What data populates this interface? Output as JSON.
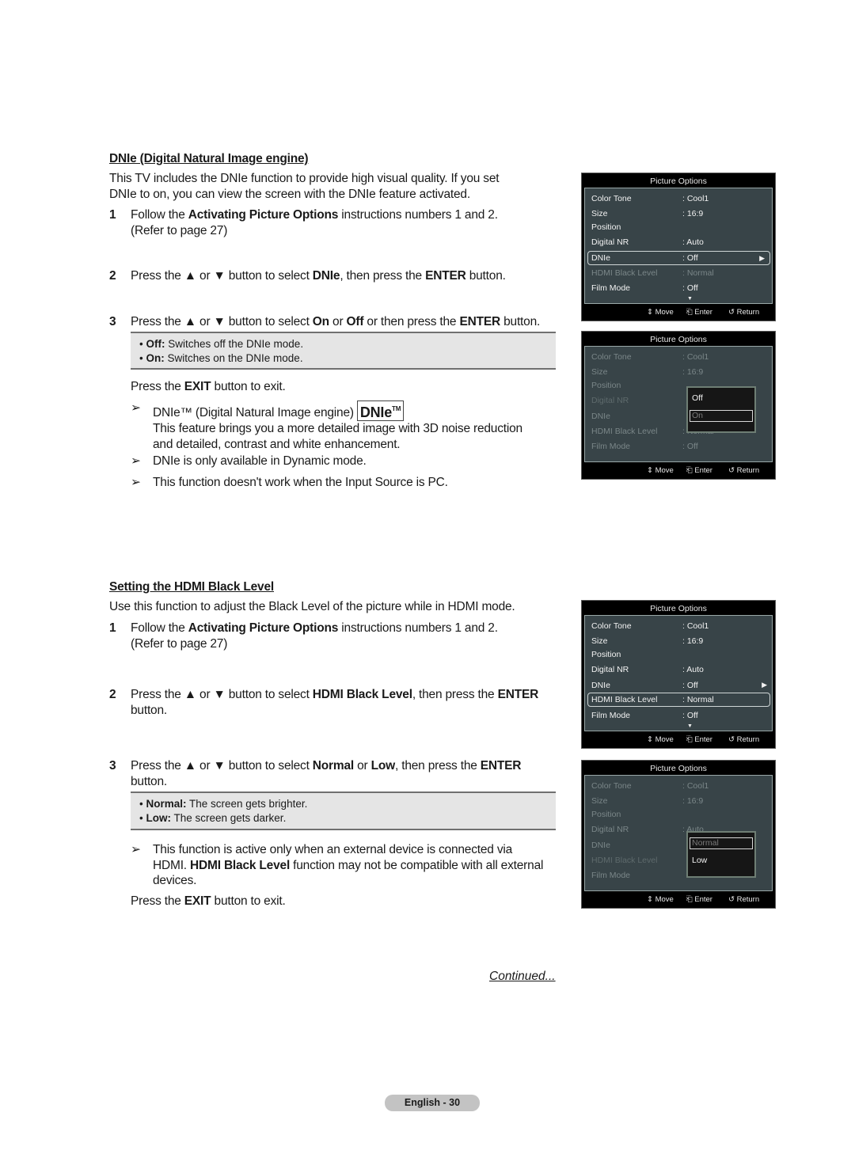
{
  "section1": {
    "heading": "DNIe (Digital Natural Image engine)",
    "intro_line1": "This TV includes the DNIe function to provide high visual quality. If you set",
    "intro_line2": "DNIe to on, you can view the screen with the DNIe feature activated.",
    "step1": {
      "num": "1",
      "pre": "Follow the ",
      "bold": "Activating Picture Options",
      "post": " instructions numbers 1 and 2.",
      "line2": "(Refer to page 27)"
    },
    "step2": {
      "num": "2",
      "a": "Press the ▲ or ▼ button to select ",
      "b1": "DNIe",
      "c": ", then press the ",
      "b2": "ENTER",
      "d": " button."
    },
    "step3": {
      "num": "3",
      "a": "Press the ▲ or ▼ button to select ",
      "b1": "On",
      "c": " or ",
      "b2": "Off",
      "d": " or then press the ",
      "b3": "ENTER",
      "e": " button."
    },
    "notes": [
      {
        "bullet": "• ",
        "term": "Off:",
        "desc": " Switches off the DNIe mode."
      },
      {
        "bullet": "• ",
        "term": "On:",
        "desc": " Switches on the DNIe mode."
      }
    ],
    "exit": {
      "pre": "Press the ",
      "bold": "EXIT",
      "post": " button to exit."
    },
    "tips": [
      {
        "arrow": "➢",
        "line1": "DNIe™ (Digital Natural Image engine)",
        "logo": "DNIe",
        "logo_tm": "TM",
        "line2": "This feature brings you a more detailed image with 3D noise reduction",
        "line3": "and detailed, contrast and white enhancement."
      },
      {
        "arrow": "➢",
        "line1": "DNIe is only available in Dynamic mode."
      },
      {
        "arrow": "➢",
        "line1": "This function doesn't work when the Input Source is PC."
      }
    ]
  },
  "section2": {
    "heading": "Setting the HDMI Black Level",
    "intro": "Use this function to adjust the Black Level of the picture while in HDMI mode.",
    "step1": {
      "num": "1",
      "pre": "Follow the ",
      "bold": "Activating Picture Options",
      "post": " instructions numbers 1 and 2.",
      "line2": "(Refer to page 27)"
    },
    "step2": {
      "num": "2",
      "a": "Press the ▲ or ▼ button to select ",
      "b1": "HDMI Black Level",
      "c": ", then press the ",
      "b2": "ENTER",
      "line2": "button."
    },
    "step3": {
      "num": "3",
      "a": "Press the ▲ or ▼ button to select ",
      "b1": "Normal",
      "c": " or ",
      "b2": "Low",
      "d": ", then press the ",
      "b3": "ENTER",
      "line2": "button."
    },
    "notes": [
      {
        "bullet": "• ",
        "term": "Normal:",
        "desc": " The screen gets brighter."
      },
      {
        "bullet": "• ",
        "term": "Low:",
        "desc": " The screen gets darker."
      }
    ],
    "tip": {
      "arrow": "➢",
      "line1": "This function is active only when an external device is connected via",
      "l2_pre": "HDMI. ",
      "l2_bold": "HDMI Black Level",
      "l2_post": " function may not be compatible with all external",
      "line3": "devices."
    },
    "exit": {
      "pre": "Press the ",
      "bold": "EXIT",
      "post": " button to exit."
    }
  },
  "menu": {
    "title": "Picture Options",
    "rows": [
      {
        "label": "Color Tone",
        "value": ": Cool1"
      },
      {
        "label": "Size",
        "value": ": 16:9"
      },
      {
        "label": "Position",
        "value": ""
      },
      {
        "label": "Digital NR",
        "value": ": Auto"
      },
      {
        "label": "DNIe",
        "value": ": Off"
      },
      {
        "label": "HDMI Black Level",
        "value": ": Normal"
      },
      {
        "label": "Film Mode",
        "value": ": Off"
      }
    ],
    "footer": {
      "move": "⇕ Move",
      "enter": "⎗ Enter",
      "return": "↺ Return"
    },
    "more_icon": "▼",
    "submenu_arrow": "▶",
    "dnie_options": [
      "Off",
      "On"
    ],
    "hdmi_options": [
      "Normal",
      "Low"
    ]
  },
  "footer": {
    "continued": "Continued...",
    "page_label": "English - 30"
  }
}
